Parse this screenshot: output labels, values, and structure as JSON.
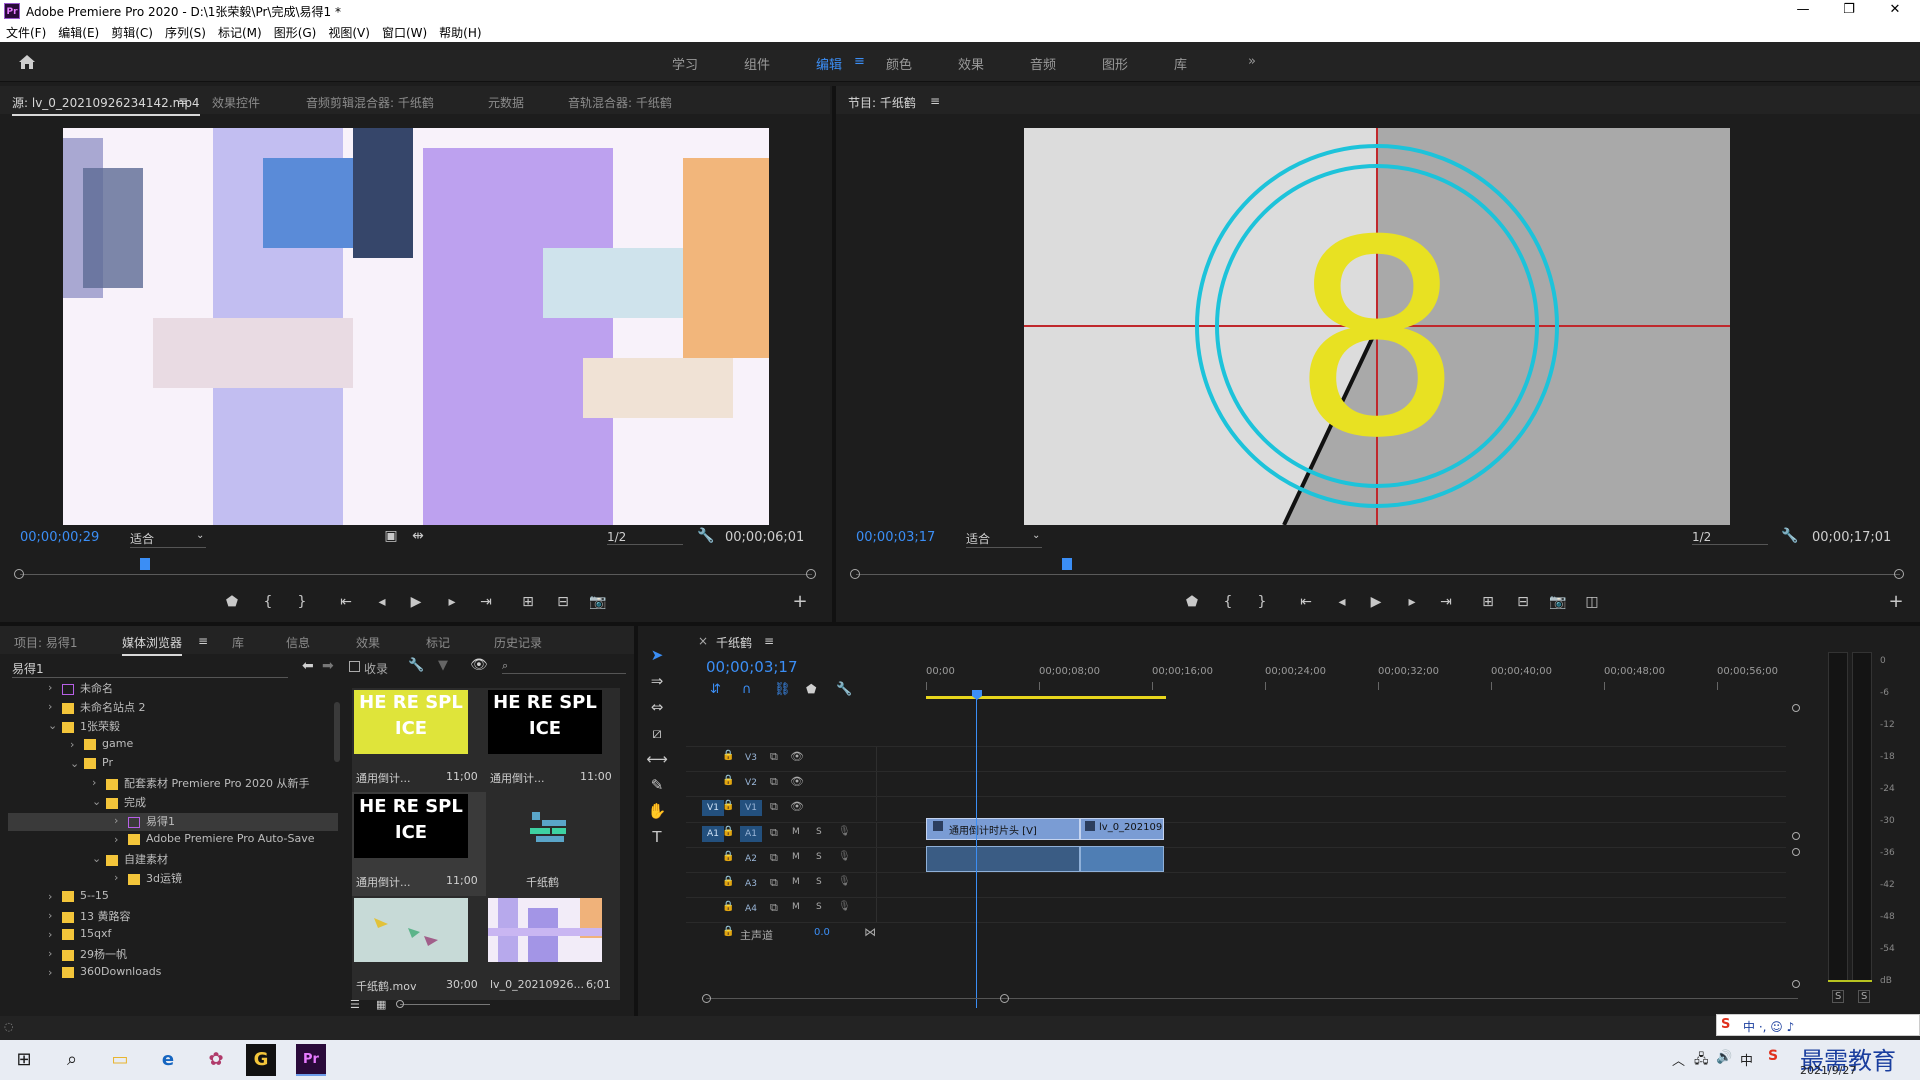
{
  "titlebar": {
    "title": "Adobe Premiere Pro 2020 - D:\\1张荣毅\\Pr\\完成\\易得1 *",
    "min": "—",
    "max": "❐",
    "close": "✕"
  },
  "menu": [
    "文件(F)",
    "编辑(E)",
    "剪辑(C)",
    "序列(S)",
    "标记(M)",
    "图形(G)",
    "视图(V)",
    "窗口(W)",
    "帮助(H)"
  ],
  "workspaces": [
    "学习",
    "组件",
    "编辑",
    "颜色",
    "效果",
    "音频",
    "图形",
    "库"
  ],
  "workspace_active": "编辑",
  "workspace_more": "»",
  "source": {
    "tabs": [
      "源: lv_0_20210926234142.mp4",
      "效果控件",
      "音频剪辑混合器: 千纸鹤",
      "元数据",
      "音轨混合器: 千纸鹤"
    ],
    "timecode": "00;00;00;29",
    "fit": "适合",
    "resolution": "1/2",
    "duration": "00;00;06;01"
  },
  "program": {
    "tab": "节目: 千纸鹤",
    "timecode": "00;00;03;17",
    "fit": "适合",
    "resolution": "1/2",
    "duration": "00;00;17;01",
    "countdown_digit": "8"
  },
  "project": {
    "tabs": [
      "项目: 易得1",
      "媒体浏览器",
      "库",
      "信息",
      "效果",
      "标记",
      "历史记录"
    ],
    "active_tab": "媒体浏览器",
    "location": "易得1",
    "ingest_label": "收录",
    "tree": [
      {
        "label": "未命名",
        "indent": 0,
        "type": "pr"
      },
      {
        "label": "未命名站点 2",
        "indent": 0,
        "type": "folder"
      },
      {
        "label": "1张荣毅",
        "indent": 0,
        "type": "folder",
        "open": true
      },
      {
        "label": "game",
        "indent": 1,
        "type": "folder"
      },
      {
        "label": "Pr",
        "indent": 1,
        "type": "folder",
        "open": true
      },
      {
        "label": "配套素材 Premiere Pro 2020 从新手",
        "indent": 2,
        "type": "folder"
      },
      {
        "label": "完成",
        "indent": 2,
        "type": "folder",
        "open": true
      },
      {
        "label": "易得1",
        "indent": 3,
        "type": "pr",
        "selected": true
      },
      {
        "label": "Adobe Premiere Pro Auto-Save",
        "indent": 3,
        "type": "folder"
      },
      {
        "label": "自建素材",
        "indent": 2,
        "type": "folder",
        "open": true
      },
      {
        "label": "3d运镜",
        "indent": 3,
        "type": "folder"
      },
      {
        "label": "5--15",
        "indent": 0,
        "type": "folder"
      },
      {
        "label": "13 黄路容",
        "indent": 0,
        "type": "folder"
      },
      {
        "label": "15qxf",
        "indent": 0,
        "type": "folder"
      },
      {
        "label": "29杨一帆",
        "indent": 0,
        "type": "folder"
      },
      {
        "label": "360Downloads",
        "indent": 0,
        "type": "folder"
      }
    ],
    "items": [
      {
        "name": "通用倒计...",
        "duration": "11;00",
        "style": "yellow",
        "splice_text": "HE RE SPL ICE"
      },
      {
        "name": "通用倒计...",
        "duration": "11:00",
        "style": "black",
        "splice_text": "HE RE SPL ICE"
      },
      {
        "name": "通用倒计...",
        "duration": "11;00",
        "style": "black",
        "splice_text": "HE RE SPL ICE"
      },
      {
        "name": "千纸鹤",
        "duration": "",
        "style": "sequence"
      },
      {
        "name": "千纸鹤.mov",
        "duration": "30;00",
        "style": "cranes"
      },
      {
        "name": "lv_0_20210926...",
        "duration": "6;01",
        "style": "paint"
      }
    ]
  },
  "timeline": {
    "tab": "千纸鹤",
    "timecode": "00;00;03;17",
    "ruler": [
      "00;00",
      "00;00;08;00",
      "00;00;16;00",
      "00;00;24;00",
      "00;00;32;00",
      "00;00;40;00",
      "00;00;48;00",
      "00;00;56;00"
    ],
    "video_tracks": [
      "V3",
      "V2",
      "V1"
    ],
    "audio_tracks": [
      "A1",
      "A2",
      "A3",
      "A4"
    ],
    "source_patch_v": "V1",
    "source_patch_a": "A1",
    "master_label": "主声道",
    "master_value": "0.0",
    "clip_v1": "通用倒计时片头 [V]",
    "clip_v2": "lv_0_202109",
    "mute": "M",
    "solo": "S"
  },
  "meter": {
    "scale": [
      "0",
      "-6",
      "-12",
      "-18",
      "-24",
      "-30",
      "-36",
      "-42",
      "-48",
      "-54",
      "dB"
    ],
    "solo_l": "S",
    "solo_r": "S"
  },
  "taskbar": {
    "time": "中 ·, ☺ ♪",
    "date": "2021/9/27",
    "ime": "中",
    "watermark": "最需教育"
  }
}
